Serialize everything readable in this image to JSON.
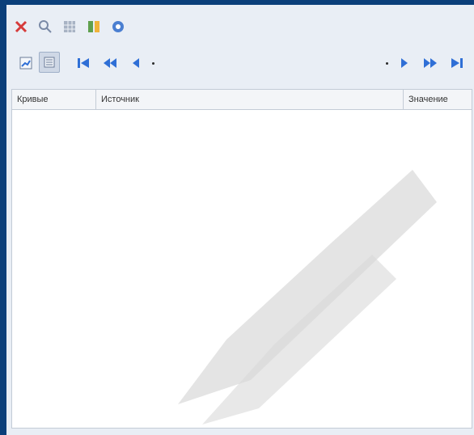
{
  "toolbar": {
    "icons_row1": [
      "close-icon",
      "search-icon",
      "grid-icon",
      "columns-icon",
      "settings-icon"
    ],
    "icons_row2_left": [
      "chart-icon",
      "list-icon"
    ],
    "nav_left": [
      "first-icon",
      "prev-prev-icon",
      "prev-icon"
    ],
    "nav_right": [
      "next-icon",
      "next-next-icon",
      "last-icon"
    ]
  },
  "table": {
    "headers": [
      "Кривые",
      "Источник",
      "Значение"
    ]
  },
  "colors": {
    "accent": "#2f6fd6",
    "window_border": "#0b3f7a",
    "panel_bg": "#e9eef5",
    "watermark": "#d9d9d9"
  }
}
